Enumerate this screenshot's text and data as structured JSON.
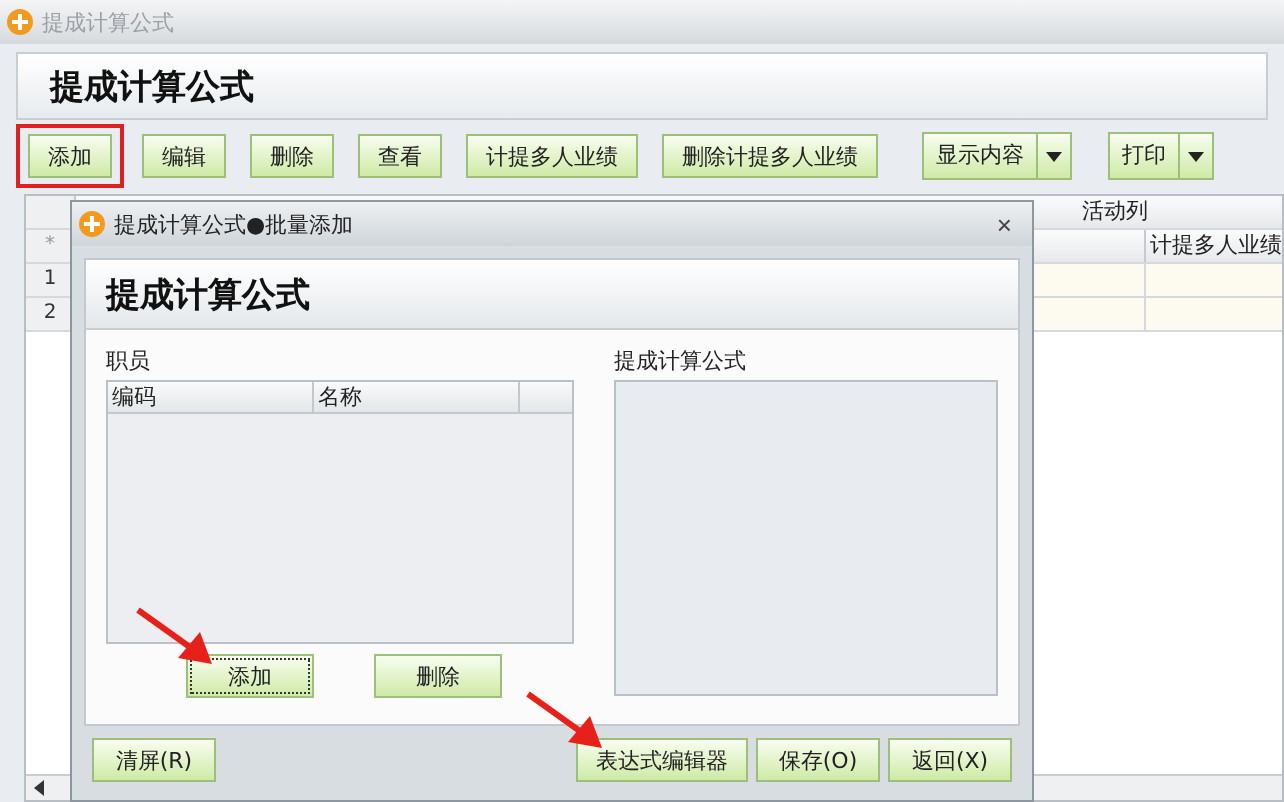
{
  "main_window": {
    "title": "提成计算公式",
    "heading": "提成计算公式",
    "toolbar": [
      {
        "label": "添加",
        "kind": "button",
        "highlighted": true
      },
      {
        "label": "编辑",
        "kind": "button",
        "highlighted": false
      },
      {
        "label": "删除",
        "kind": "button",
        "highlighted": false
      },
      {
        "label": "查看",
        "kind": "button",
        "highlighted": false
      },
      {
        "label": "计提多人业绩",
        "kind": "button",
        "highlighted": false
      },
      {
        "label": "删除计提多人业绩",
        "kind": "button",
        "highlighted": false
      },
      {
        "label": "显示内容",
        "kind": "dropdown",
        "highlighted": false
      },
      {
        "label": "打印",
        "kind": "dropdown",
        "highlighted": false
      }
    ],
    "grid": {
      "group_header": "活动列",
      "corner": "*",
      "columns": [
        "计提多人业绩"
      ],
      "rows": [
        "1",
        "2"
      ]
    }
  },
  "dialog": {
    "title": "提成计算公式●批量添加",
    "close": "×",
    "heading": "提成计算公式",
    "staff": {
      "label": "职员",
      "columns": [
        "编码",
        "名称"
      ],
      "buttons": [
        {
          "label": "添加",
          "focused": true,
          "arrow": true
        },
        {
          "label": "删除",
          "focused": false,
          "arrow": false
        }
      ]
    },
    "formula": {
      "label": "提成计算公式"
    },
    "footer_buttons": [
      {
        "label": "清屏(R)",
        "arrow": false
      },
      {
        "label": "表达式编辑器",
        "arrow": true
      },
      {
        "label": "保存(O)",
        "arrow": false
      },
      {
        "label": "返回(X)",
        "arrow": false
      }
    ]
  }
}
